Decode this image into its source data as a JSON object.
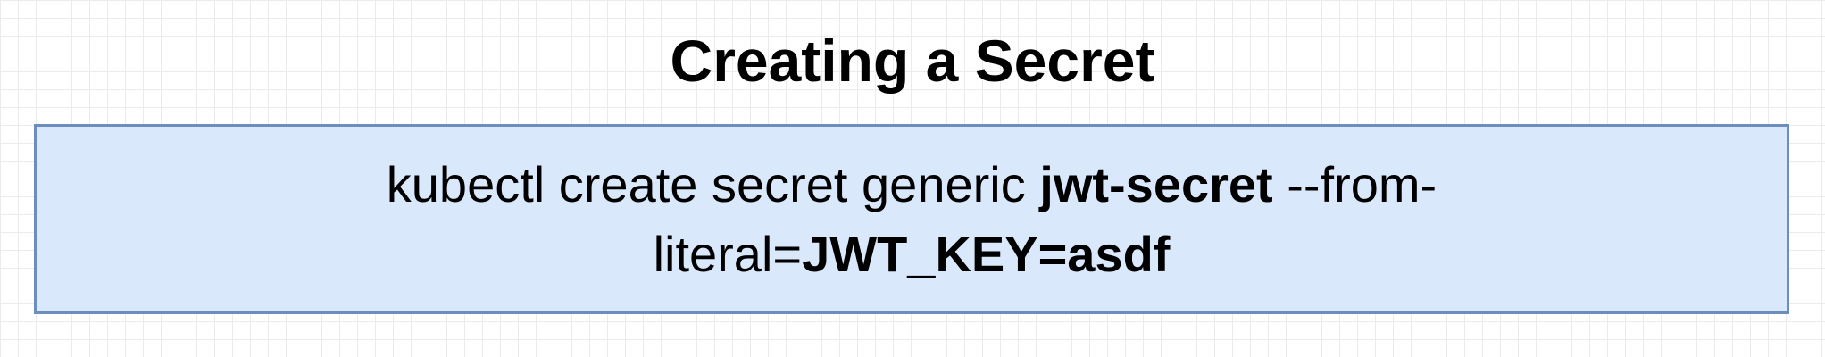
{
  "diagram": {
    "title": "Creating a Secret",
    "command": {
      "line1_plain_a": "kubectl create secret generic ",
      "line1_bold": "jwt-secret",
      "line1_plain_b": " --from-",
      "line2_plain": "literal=",
      "line2_bold": "JWT_KEY=asdf"
    },
    "colors": {
      "box_fill": "#dae8fc",
      "box_border": "#6c8ebf",
      "grid": "#ebebeb"
    }
  }
}
